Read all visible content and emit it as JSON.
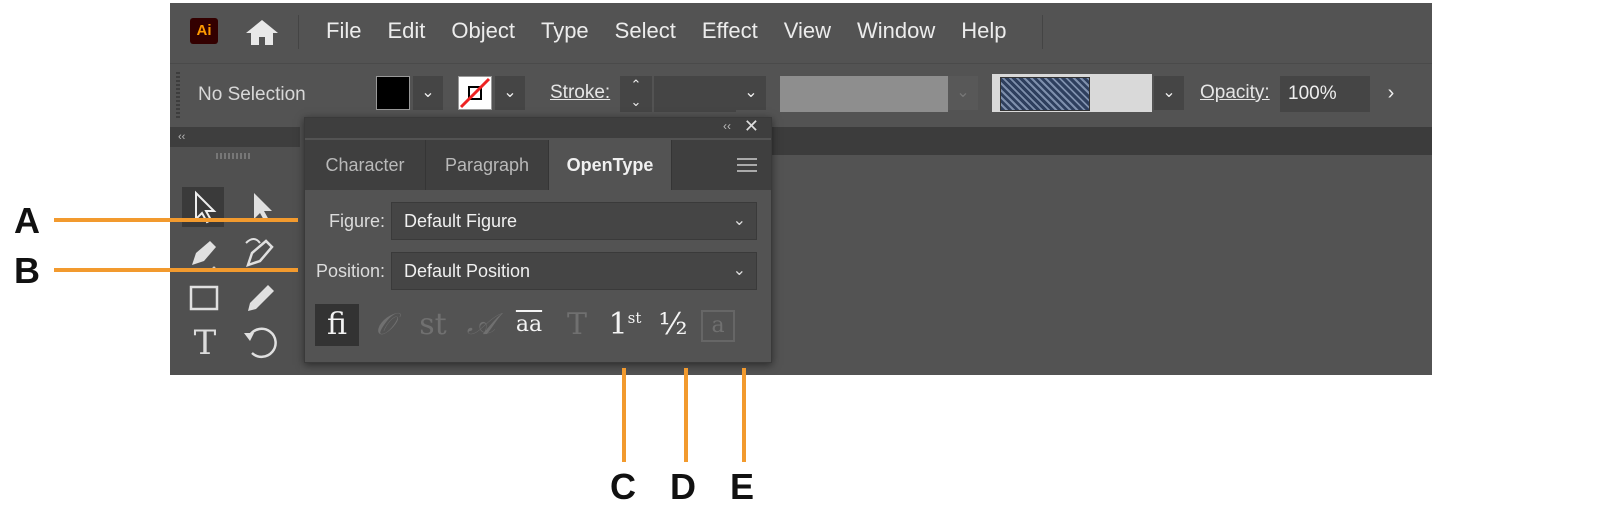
{
  "app": {
    "logo": "Ai",
    "menu": [
      "File",
      "Edit",
      "Object",
      "Type",
      "Select",
      "Effect",
      "View",
      "Window",
      "Help"
    ]
  },
  "control_bar": {
    "selection": "No Selection",
    "stroke_label": "Stroke:",
    "opacity_label": "Opacity:",
    "opacity_value": "100%"
  },
  "panel": {
    "tabs": [
      "Character",
      "Paragraph",
      "OpenType"
    ],
    "active_tab": "OpenType",
    "figure_label": "Figure:",
    "figure_value": "Default Figure",
    "position_label": "Position:",
    "position_value": "Default Position",
    "glyph_buttons": [
      {
        "glyph": "fi",
        "name": "standard-ligatures",
        "state": "active"
      },
      {
        "glyph": "𝒪",
        "name": "contextual-alternates",
        "state": "disabled"
      },
      {
        "glyph": "st",
        "name": "discretionary-ligatures",
        "state": "disabled"
      },
      {
        "glyph": "𝒜",
        "name": "swash",
        "state": "disabled"
      },
      {
        "glyph": "aa",
        "name": "stylistic-alternates",
        "state": "enabled"
      },
      {
        "glyph": "T",
        "name": "titling-alternates",
        "state": "disabled"
      },
      {
        "glyph": "1",
        "sup": "st",
        "name": "ordinals",
        "state": "enabled"
      },
      {
        "glyph": "½",
        "name": "fractions",
        "state": "enabled"
      },
      {
        "glyph": "a",
        "name": "stylistic-sets",
        "state": "disabled"
      }
    ]
  },
  "callouts": [
    "A",
    "B",
    "C",
    "D",
    "E"
  ],
  "colors": {
    "callout": "#f29a2e",
    "ui": "#535353"
  }
}
